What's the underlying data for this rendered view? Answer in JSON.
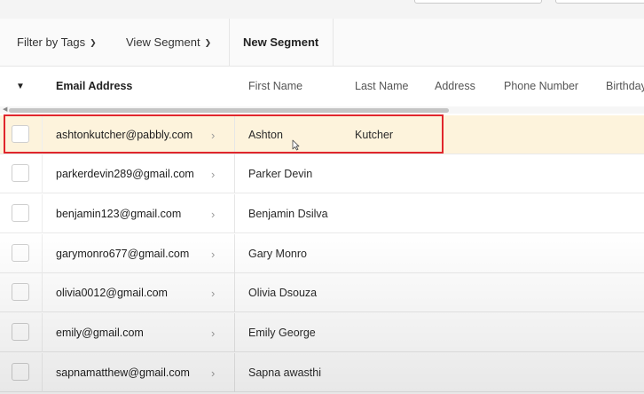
{
  "toolbar": {
    "filter_label": "Filter by Tags",
    "segment_label": "View Segment",
    "new_segment_label": "New Segment"
  },
  "columns": [
    "Email Address",
    "First Name",
    "Last Name",
    "Address",
    "Phone Number",
    "Birthday"
  ],
  "rows": [
    {
      "email": "ashtonkutcher@pabbly.com",
      "first": "Ashton",
      "last": "Kutcher",
      "selected": true
    },
    {
      "email": "parkerdevin289@gmail.com",
      "first": "Parker Devin",
      "last": ""
    },
    {
      "email": "benjamin123@gmail.com",
      "first": "Benjamin Dsilva",
      "last": ""
    },
    {
      "email": "garymonro677@gmail.com",
      "first": "Gary Monro",
      "last": ""
    },
    {
      "email": "olivia0012@gmail.com",
      "first": "Olivia Dsouza",
      "last": ""
    },
    {
      "email": "emily@gmail.com",
      "first": "Emily George",
      "last": ""
    },
    {
      "email": "sapnamatthew@gmail.com",
      "first": "Sapna awasthi",
      "last": ""
    }
  ],
  "icons": {
    "dropdown": "chevron-down-icon",
    "row_expand": "chevron-right-icon",
    "cursor": "mouse-pointer-icon"
  },
  "colors": {
    "selected_row": "#fdf3dc",
    "highlight_border": "#e0262c"
  }
}
